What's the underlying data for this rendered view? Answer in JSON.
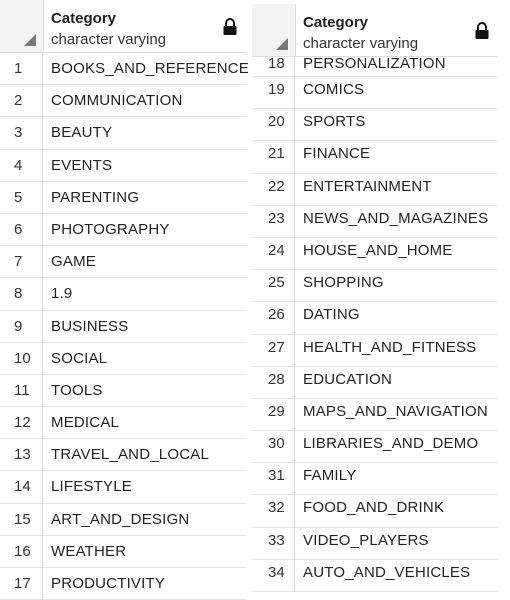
{
  "left_grid": {
    "header": {
      "column_name": "Category",
      "column_type": "character varying"
    },
    "rows": [
      {
        "n": "1",
        "v": "BOOKS_AND_REFERENCE"
      },
      {
        "n": "2",
        "v": "COMMUNICATION"
      },
      {
        "n": "3",
        "v": "BEAUTY"
      },
      {
        "n": "4",
        "v": "EVENTS"
      },
      {
        "n": "5",
        "v": "PARENTING"
      },
      {
        "n": "6",
        "v": "PHOTOGRAPHY"
      },
      {
        "n": "7",
        "v": "GAME"
      },
      {
        "n": "8",
        "v": "1.9"
      },
      {
        "n": "9",
        "v": "BUSINESS"
      },
      {
        "n": "10",
        "v": "SOCIAL"
      },
      {
        "n": "11",
        "v": "TOOLS"
      },
      {
        "n": "12",
        "v": "MEDICAL"
      },
      {
        "n": "13",
        "v": "TRAVEL_AND_LOCAL"
      },
      {
        "n": "14",
        "v": "LIFESTYLE"
      },
      {
        "n": "15",
        "v": "ART_AND_DESIGN"
      },
      {
        "n": "16",
        "v": "WEATHER"
      },
      {
        "n": "17",
        "v": "PRODUCTIVITY"
      }
    ]
  },
  "right_grid": {
    "header": {
      "column_name": "Category",
      "column_type": "character varying"
    },
    "rows": [
      {
        "n": "18",
        "v": "PERSONALIZATION"
      },
      {
        "n": "19",
        "v": "COMICS"
      },
      {
        "n": "20",
        "v": "SPORTS"
      },
      {
        "n": "21",
        "v": "FINANCE"
      },
      {
        "n": "22",
        "v": "ENTERTAINMENT"
      },
      {
        "n": "23",
        "v": "NEWS_AND_MAGAZINES"
      },
      {
        "n": "24",
        "v": "HOUSE_AND_HOME"
      },
      {
        "n": "25",
        "v": "SHOPPING"
      },
      {
        "n": "26",
        "v": "DATING"
      },
      {
        "n": "27",
        "v": "HEALTH_AND_FITNESS"
      },
      {
        "n": "28",
        "v": "EDUCATION"
      },
      {
        "n": "29",
        "v": "MAPS_AND_NAVIGATION"
      },
      {
        "n": "30",
        "v": "LIBRARIES_AND_DEMO"
      },
      {
        "n": "31",
        "v": "FAMILY"
      },
      {
        "n": "32",
        "v": "FOOD_AND_DRINK"
      },
      {
        "n": "33",
        "v": "VIDEO_PLAYERS"
      },
      {
        "n": "34",
        "v": "AUTO_AND_VEHICLES"
      }
    ]
  },
  "icons": {
    "lock": "lock-icon",
    "sort": "select-all-corner-icon"
  }
}
